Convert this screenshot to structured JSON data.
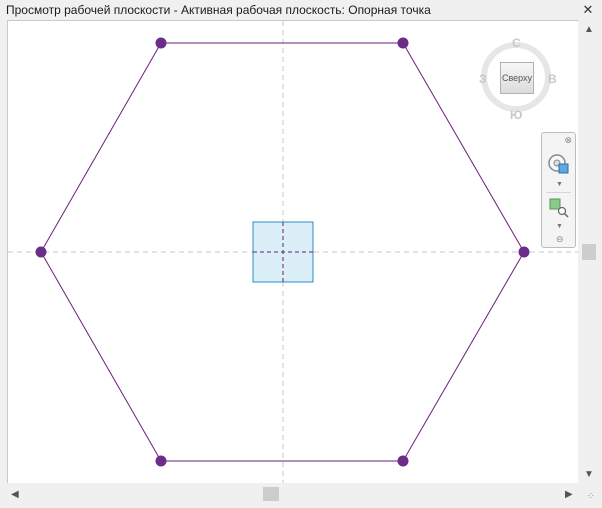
{
  "window": {
    "title": "Просмотр рабочей плоскости - Активная рабочая плоскость: Опорная точка",
    "close_glyph": "✕"
  },
  "viewcube": {
    "face_label": "Сверху",
    "north": "С",
    "south": "Ю",
    "east": "В",
    "west": "З"
  },
  "navbar": {
    "close_glyph": "⊗",
    "dropdown_glyph": "▼",
    "bottom_glyph": "⊖",
    "tools": [
      "steering-wheel-icon",
      "zoom-region-icon"
    ]
  },
  "scrollbars": {
    "up": "▲",
    "down": "▼",
    "left": "◀",
    "right": "▶",
    "grip": "⁘"
  },
  "drawing": {
    "shape": "hexagon",
    "vertices": 6,
    "outline_color": "#6b1f7a",
    "vertex_color": "#6b2c8a",
    "reference_lines_color": "#c8c8c8",
    "origin_box_fill": "#d9eef7",
    "origin_box_border": "#2a8ec0"
  },
  "colors": {
    "canvas_bg": "#ffffff",
    "chrome_bg": "#f0f0f0"
  }
}
